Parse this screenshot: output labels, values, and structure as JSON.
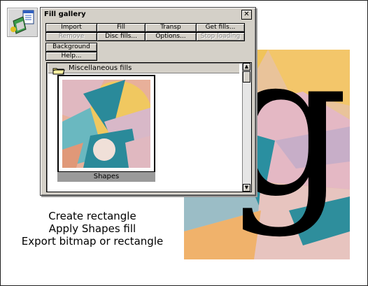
{
  "window": {
    "title": "Fill gallery",
    "close_glyph": "✕",
    "buttons": [
      {
        "label": "Import",
        "enabled": true
      },
      {
        "label": "Fill",
        "enabled": true
      },
      {
        "label": "Transp",
        "enabled": true
      },
      {
        "label": "Get fills...",
        "enabled": true
      },
      {
        "label": "Remove",
        "enabled": false
      },
      {
        "label": "Disc fills...",
        "enabled": true
      },
      {
        "label": "Options...",
        "enabled": true
      },
      {
        "label": "Stop loading",
        "enabled": false
      },
      {
        "label": "Background",
        "enabled": true
      },
      {
        "label": "Help...",
        "enabled": true
      }
    ],
    "section": {
      "label": "Miscellaneous fills",
      "icon": "folder-icon"
    },
    "item": {
      "label": "Shapes",
      "selected": true
    },
    "scrollbar": {
      "up_glyph": "▲",
      "down_glyph": "▼"
    }
  },
  "instructions": [
    "Create rectangle",
    "Apply Shapes fill",
    "Export bitmap or rectangle"
  ],
  "artwork": {
    "glyph": "g"
  },
  "app_icon": "fill-gallery-icon",
  "colors": {
    "panel": "#d4d0c8",
    "thumb_label_bg": "#9a9a9a",
    "teal": "#2a8a9a",
    "orange": "#f0a850",
    "pink": "#e0b8c0",
    "yellow": "#f0c860"
  }
}
